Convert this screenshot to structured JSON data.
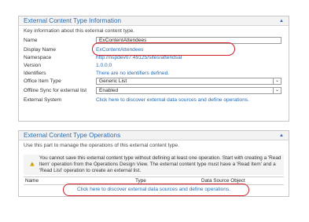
{
  "info_panel": {
    "title": "External Content Type Information",
    "description": "Key information about this external content type.",
    "fields": {
      "name_label": "Name",
      "name_value": "ExContentAttendees",
      "display_name_label": "Display Name",
      "display_name_value": "ExContentAttendees",
      "namespace_label": "Namespace",
      "namespace_value": "http://nspdev07:49125/sites/attendsal",
      "version_label": "Version",
      "version_value": "1.0.0.0",
      "identifiers_label": "Identifiers",
      "identifiers_value": "There are no identifiers defined.",
      "office_item_type_label": "Office Item Type",
      "office_item_type_value": "Generic List",
      "offline_sync_label": "Offline Sync for external list",
      "offline_sync_value": "Enabled",
      "external_system_label": "External System",
      "external_system_link": "Click here to discover external data sources and define operations."
    }
  },
  "ops_panel": {
    "title": "External Content Type Operations",
    "description": "Use this part to manage the operations of this external content type.",
    "warning": "You cannot save this external content type without defining at least one operation. Start with creating a 'Read Item' operation from the Operations Design View. The external content type must have a 'Read Item' and a 'Read List' operation to create an external list.",
    "columns": [
      "Name",
      "Type",
      "Data Source Object"
    ],
    "link": "Click here to discover external data sources and define operations."
  },
  "colors": {
    "accent": "#2a6bb0",
    "highlight_oval": "#d31f2a",
    "warning": "#f2c200"
  },
  "icons": {
    "collapse": "collapse-icon",
    "warning": "warning-icon",
    "dropdown": "chevron-down-icon"
  }
}
